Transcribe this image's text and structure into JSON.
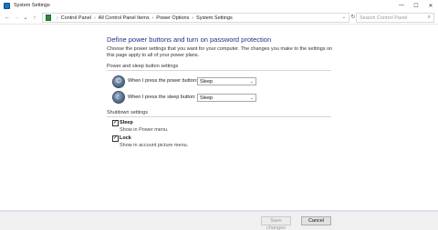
{
  "window": {
    "title": "System Settings",
    "controls": [
      "—",
      "☐",
      "✕"
    ]
  },
  "navigation": {
    "back": "←",
    "forward": "→",
    "up": "↑",
    "recent": "⌄"
  },
  "breadcrumb": {
    "items": [
      "Control Panel",
      "All Control Panel Items",
      "Power Options",
      "System Settings"
    ],
    "separator": "›"
  },
  "search": {
    "placeholder": "Search Control Panel"
  },
  "page": {
    "heading": "Define power buttons and turn on password protection",
    "intro": "Choose the power settings that you want for your computer. The changes you make to the settings on this page apply to all of your power plans."
  },
  "power_section": {
    "label": "Power and sleep button settings",
    "rows": [
      {
        "label": "When I press the power button:",
        "value": "Sleep"
      },
      {
        "label": "When I press the sleep button:",
        "value": "Sleep"
      }
    ]
  },
  "shutdown_section": {
    "label": "Shutdown settings",
    "items": [
      {
        "label": "Sleep",
        "description": "Show in Power menu.",
        "checked": true
      },
      {
        "label": "Lock",
        "description": "Show in account picture menu.",
        "checked": true
      }
    ]
  },
  "footer": {
    "save_label": "Save changes",
    "cancel_label": "Cancel"
  },
  "colors": {
    "heading": "#1e3287",
    "accent_band": "#dde0f2"
  }
}
